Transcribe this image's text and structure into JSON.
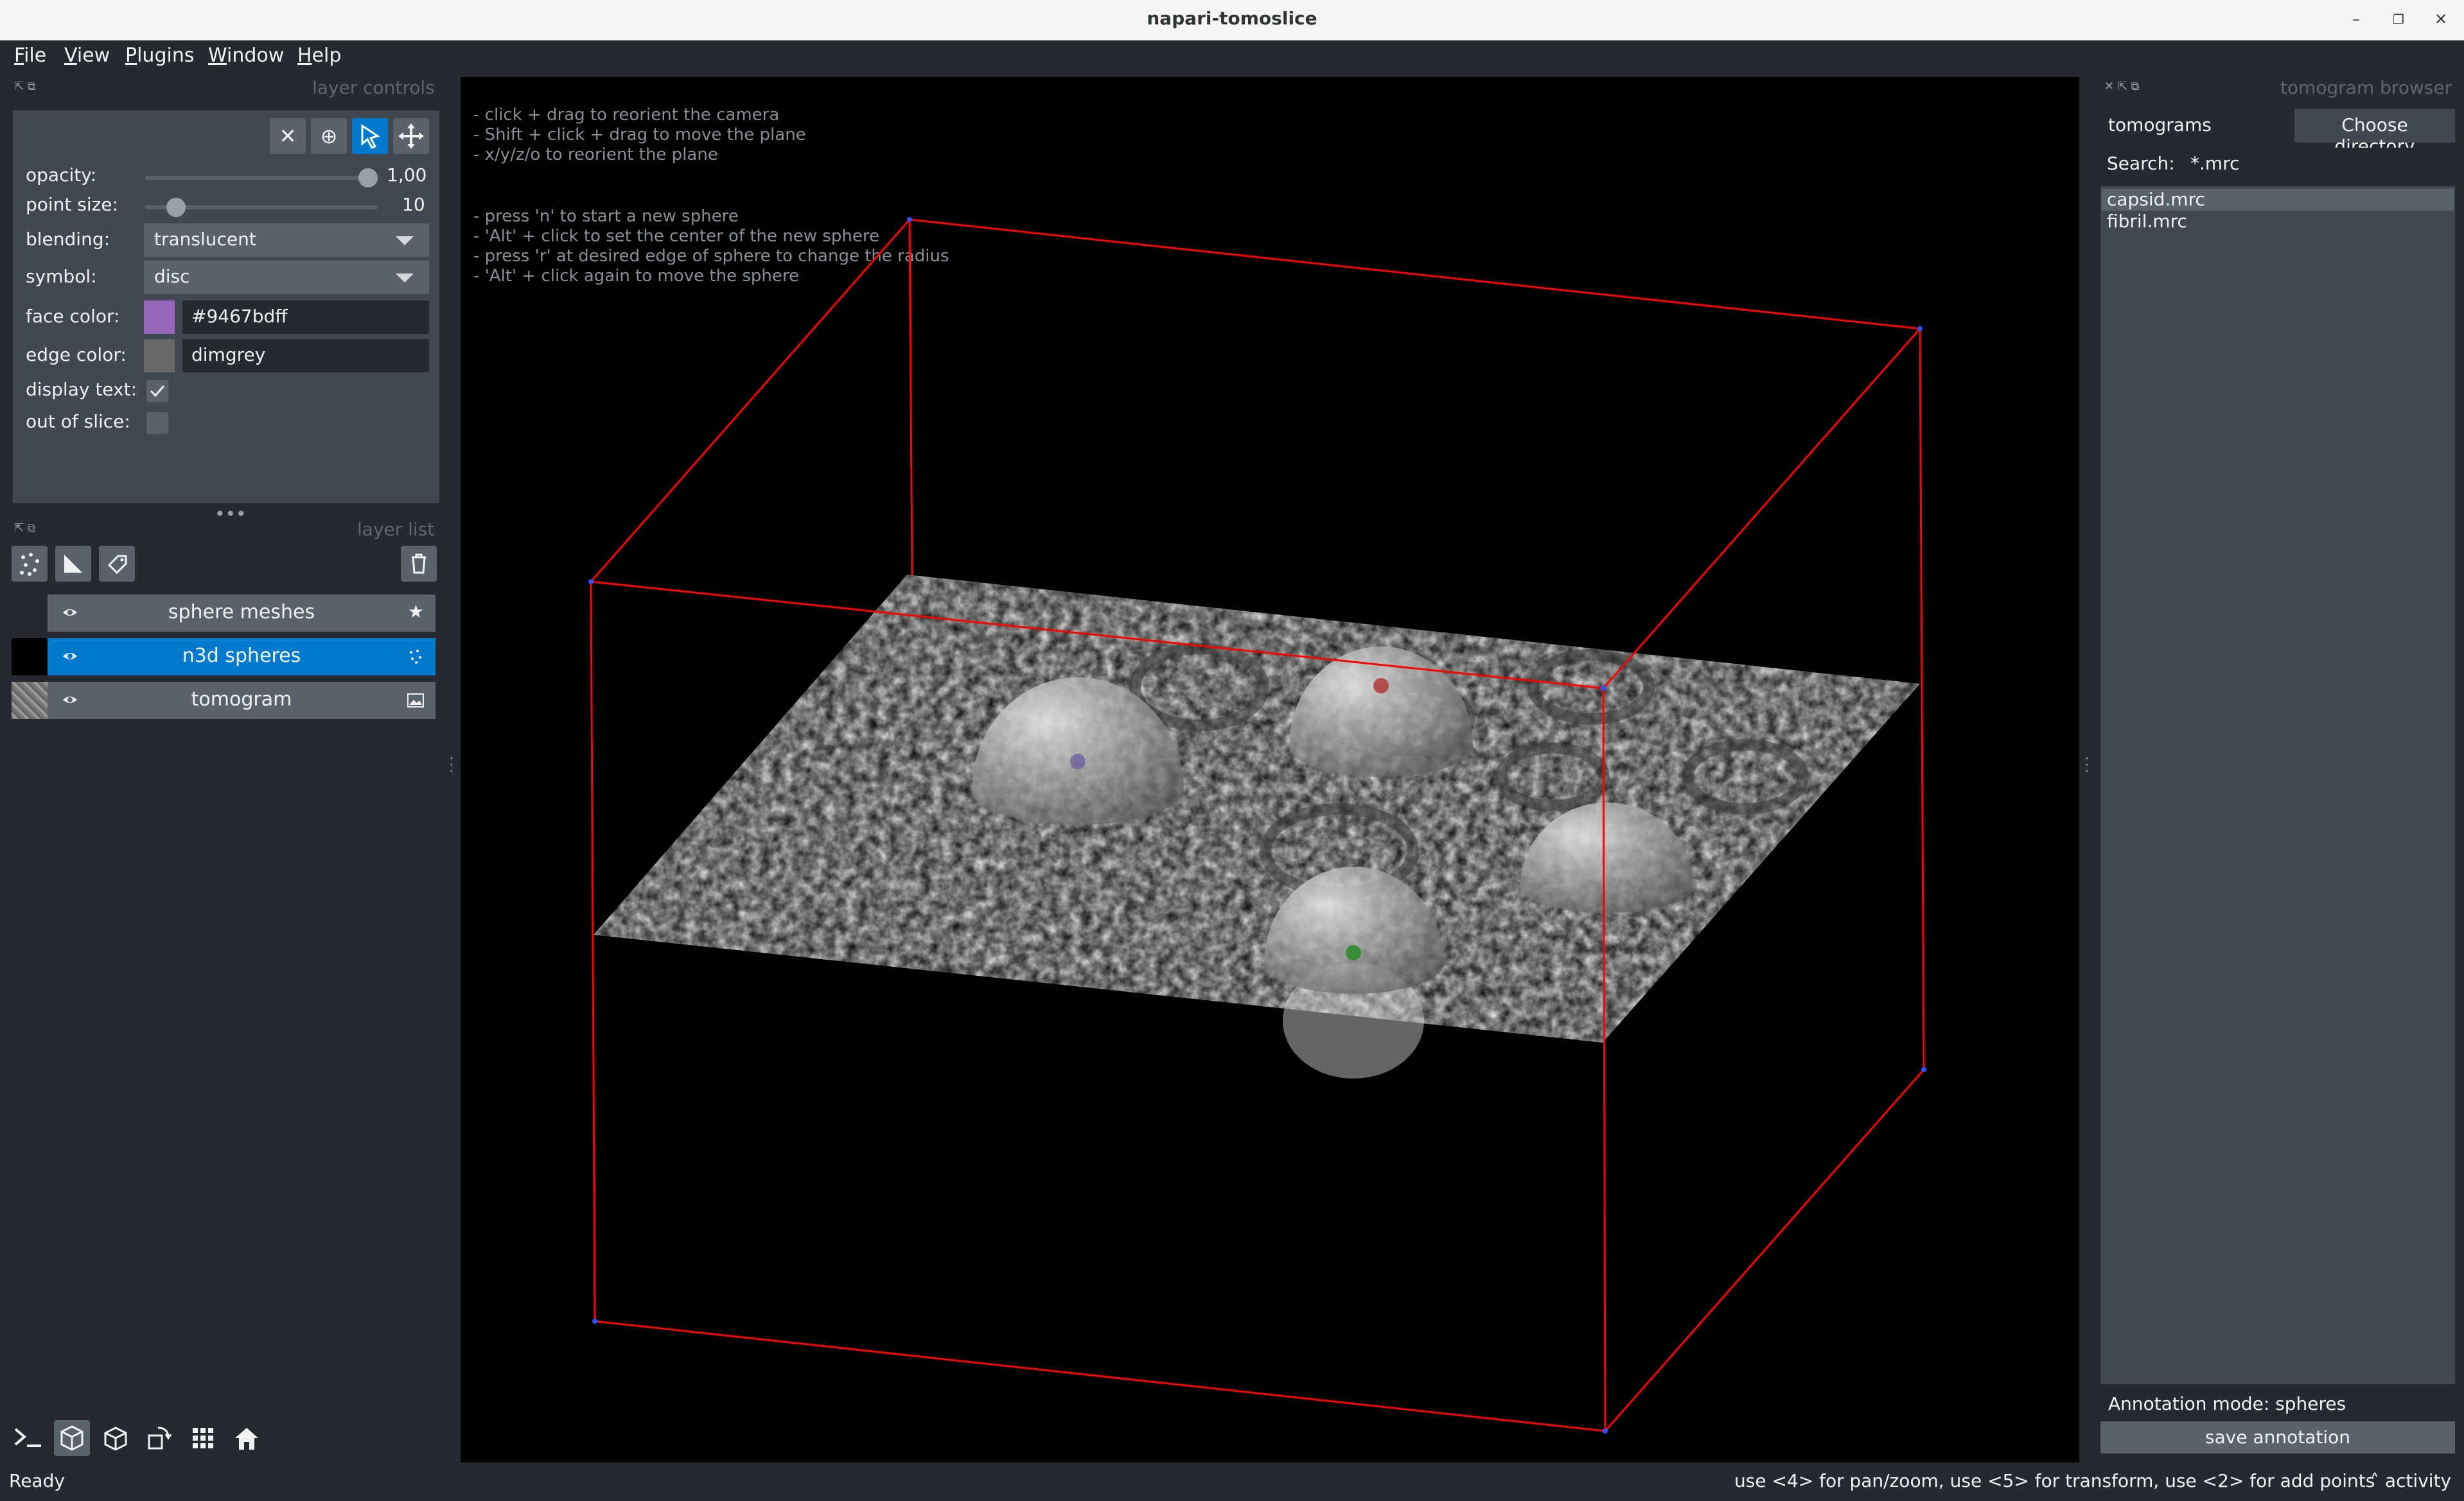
{
  "window": {
    "title": "napari-tomoslice"
  },
  "menu": [
    {
      "accel": "F",
      "rest": "ile"
    },
    {
      "accel": "V",
      "rest": "iew"
    },
    {
      "accel": "P",
      "rest": "lugins"
    },
    {
      "accel": "W",
      "rest": "indow"
    },
    {
      "accel": "H",
      "rest": "elp"
    }
  ],
  "layer_controls": {
    "dock_title": "layer controls",
    "opacity_label": "opacity:",
    "opacity_value": "1,00",
    "opacity_fraction": 1.0,
    "point_size_label": "point size:",
    "point_size_value": "10",
    "point_size_fraction": 0.1,
    "blending_label": "blending:",
    "blending_value": "translucent",
    "symbol_label": "symbol:",
    "symbol_value": "disc",
    "face_color_label": "face color:",
    "face_color_value": "#9467bdff",
    "face_color": "#9467bd",
    "edge_color_label": "edge color:",
    "edge_color_value": "dimgrey",
    "edge_color": "#696969",
    "display_text_label": "display text:",
    "display_text_checked": true,
    "out_of_slice_label": "out of slice:",
    "out_of_slice_checked": false
  },
  "layer_list": {
    "dock_title": "layer list",
    "layers": [
      {
        "name": "sphere meshes",
        "type_icon": "star-icon",
        "selected": false
      },
      {
        "name": "n3d spheres",
        "type_icon": "points-icon",
        "selected": true
      },
      {
        "name": "tomogram",
        "type_icon": "image-icon",
        "selected": false
      }
    ]
  },
  "viewer": {
    "hints_block1": "- click + drag to reorient the camera\n- Shift + click + drag to move the plane\n- x/y/z/o to reorient the plane",
    "hints_block2": "- press 'n' to start a new sphere\n- 'Alt' + click to set the center of the new sphere\n- press 'r' at desired edge of sphere to change the radius\n- 'Alt' + click again to move the sphere",
    "bbox_color": "#ff0000"
  },
  "tomogram_browser": {
    "dock_title": "tomogram browser",
    "dir_value": "tomograms",
    "choose_button": "Choose directory",
    "search_label": "Search:",
    "search_value": "*.mrc",
    "files": [
      {
        "name": "capsid.mrc",
        "selected": true
      },
      {
        "name": "fibril.mrc",
        "selected": false
      }
    ],
    "annotation_mode": "Annotation mode: spheres",
    "save_button": "save annotation"
  },
  "status": {
    "left": "Ready",
    "right": "use <4> for pan/zoom, use <5> for transform, use <2> for add points",
    "activity": "activity"
  },
  "colors": {
    "selected_layer": "#007acc",
    "panel": "#414851",
    "background": "#262930"
  }
}
